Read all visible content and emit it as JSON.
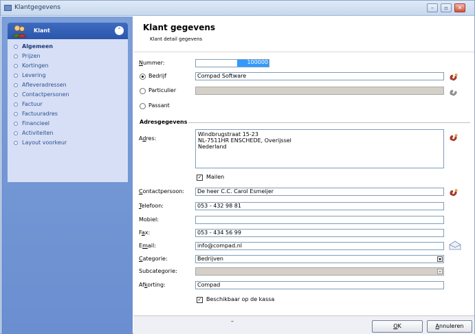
{
  "window": {
    "title": "Klantgegevens",
    "buttons": {
      "minimize": "–",
      "maximize": "▫",
      "close": "✕"
    }
  },
  "sidebar": {
    "panel_title": "Klant",
    "collapse_glyph": "⌃",
    "items": [
      {
        "label": "Algemeen",
        "active": true
      },
      {
        "label": "Prijzen"
      },
      {
        "label": "Kortingen"
      },
      {
        "label": "Levering"
      },
      {
        "label": "Afleveradressen"
      },
      {
        "label": "Contactpersonen"
      },
      {
        "label": "Factuur"
      },
      {
        "label": "Factuuradres"
      },
      {
        "label": "Financieel"
      },
      {
        "label": "Activiteiten"
      },
      {
        "label": "Layout voorkeur"
      }
    ]
  },
  "header": {
    "title": "Klant gegevens",
    "subtitle": "Klant detail gegevens"
  },
  "form": {
    "nummer_label_u": "N",
    "nummer_label_rest": "ummer:",
    "nummer_value": "100000",
    "bedrijf_label": "Bedrijf",
    "bedrijf_value": "Compad Software",
    "particulier_label": "Particulier",
    "particulier_value": "",
    "passant_label": "Passant",
    "section_adres": "Adresgegevens",
    "adres_label_pre": "A",
    "adres_label_u": "d",
    "adres_label_rest": "res:",
    "adres_value": "Windbrugstraat 15-23\nNL-7511HR  ENSCHEDE, Overijssel\nNederland",
    "mailen_label": "Mailen",
    "contact_label_u": "C",
    "contact_label_rest": "ontactpersoon:",
    "contact_value": "De heer C.C. Carol Esmeijer",
    "telefoon_label_u": "T",
    "telefoon_label_rest": "elefoon:",
    "telefoon_value": "053 - 432 98 81",
    "mobiel_label": "Mobiel:",
    "mobiel_value": "",
    "fax_label_pre": "F",
    "fax_label_u": "a",
    "fax_label_rest": "x:",
    "fax_value": "053 - 434 56 99",
    "email_label_pre": "E",
    "email_label_u": "m",
    "email_label_rest": "ail:",
    "email_value": "info@compad.nl",
    "categorie_label_u": "C",
    "categorie_label_rest": "ategorie:",
    "categorie_value": "Bedrijven",
    "subcategorie_label": "Subcategorie:",
    "subcategorie_value": "",
    "afkorting_label_pre": "Af",
    "afkorting_label_u": "k",
    "afkorting_label_rest": "orting:",
    "afkorting_value": "Compad",
    "kassa_label": "Beschikbaar op de kassa"
  },
  "footer": {
    "dash": "–",
    "ok_u": "O",
    "ok_rest": "K",
    "cancel_u": "A",
    "cancel_rest": "nnuleren"
  },
  "colors": {
    "sidebar_bg": "#7d9fd8",
    "panel_header": "#2a56ab",
    "selection": "#3399ff"
  },
  "icons": [
    "window-app-icon",
    "user-group-icon",
    "collapse-icon",
    "telephone-icon",
    "envelope-icon"
  ]
}
